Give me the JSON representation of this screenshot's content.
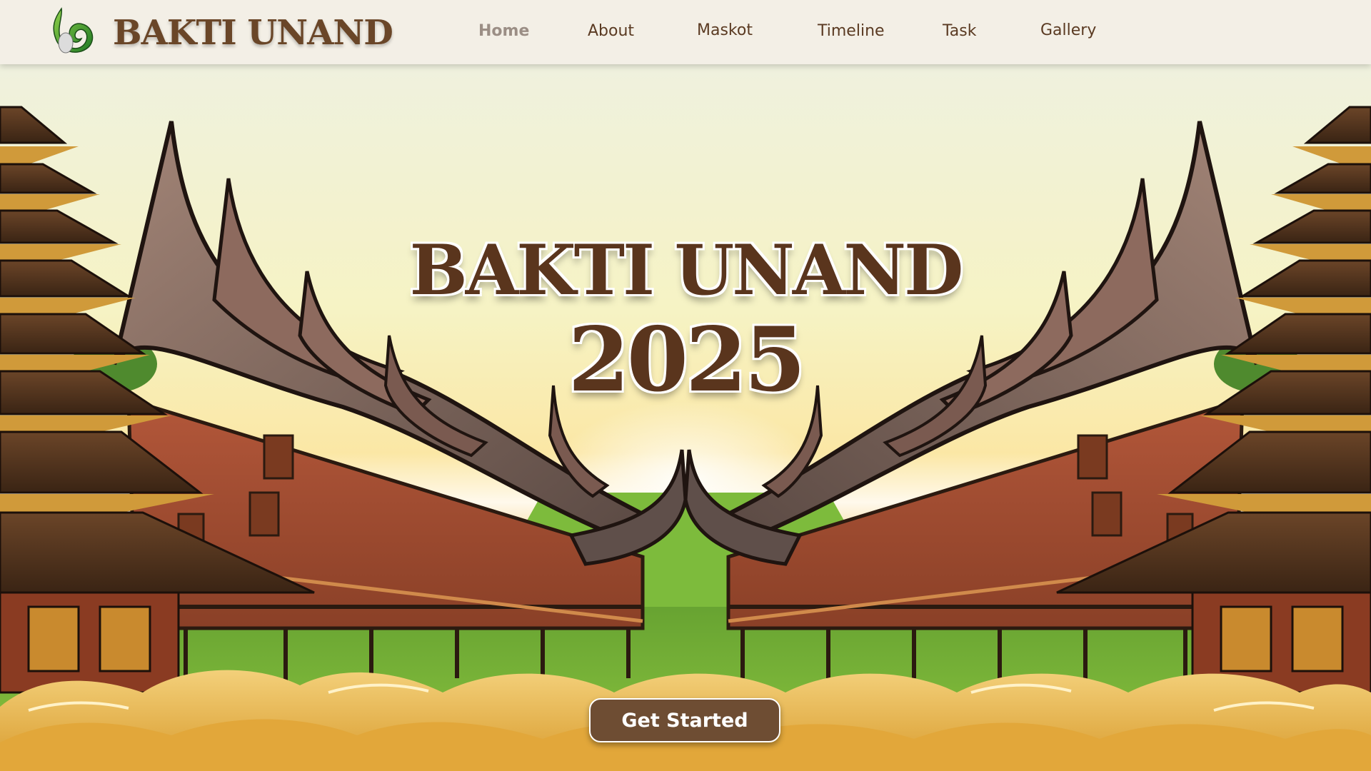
{
  "brand": {
    "name": "BAKTI UNAND",
    "logo_icon": "leaf-logo-icon"
  },
  "nav": {
    "items": [
      {
        "label": "Home",
        "active": true
      },
      {
        "label": "About"
      },
      {
        "label": "Maskot"
      },
      {
        "label": "Timeline"
      },
      {
        "label": "Task"
      },
      {
        "label": "Gallery"
      }
    ]
  },
  "hero": {
    "title": "BAKTI UNAND",
    "year": "2025",
    "cta_label": "Get Started",
    "background": "illustration-rumah-gadang-and-pagoda-towers"
  },
  "colors": {
    "primary_brown": "#5a351d",
    "nav_bg": "#f3efe6",
    "button_bg": "#6e4d33",
    "grass": "#7ab33c",
    "sky_glow": "#fbe7a5"
  }
}
